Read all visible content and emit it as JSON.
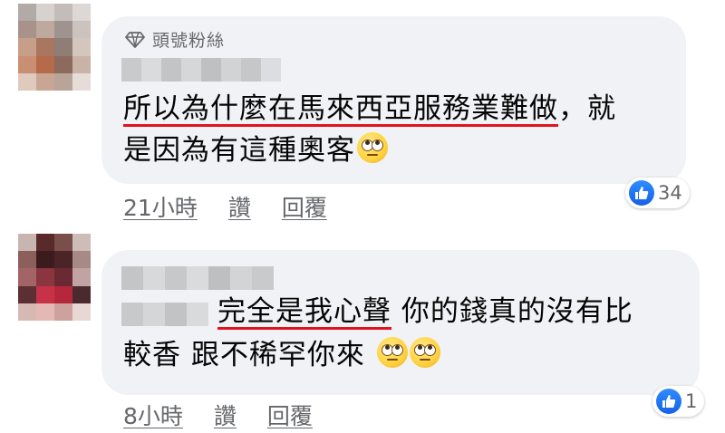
{
  "comments": [
    {
      "badge": {
        "icon": "diamond-icon",
        "label": "頭號粉絲"
      },
      "text": {
        "highlight": "所以為什麼在馬來西亞服務業難做",
        "line1_rest": "，就",
        "line2": "是因為有這種奧客"
      },
      "emoji": "face-with-rolling-eyes-icon",
      "time": "21小時",
      "like_label": "讚",
      "reply_label": "回覆",
      "reaction": {
        "icon": "like-icon",
        "count": "34"
      }
    },
    {
      "text": {
        "highlight": "完全是我心聲",
        "line1_rest": " 你的錢真的沒有比",
        "line2": "較香 跟不稀罕你來"
      },
      "emoji": "face-with-rolling-eyes-icon",
      "time": "8小時",
      "like_label": "讚",
      "reply_label": "回覆",
      "reaction": {
        "icon": "like-icon",
        "count": "1"
      }
    }
  ],
  "colors": {
    "bubble": "#f0f2f5",
    "underline": "#e0141e",
    "like_blue": "#1877f2",
    "meta_gray": "#65676b"
  }
}
